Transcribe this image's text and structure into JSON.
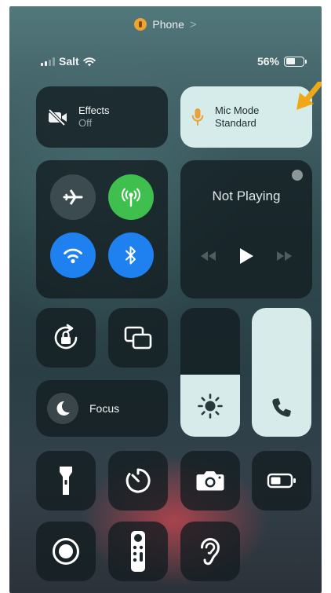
{
  "banner": {
    "app": "Phone",
    "chevron": ">"
  },
  "status": {
    "carrier": "Salt",
    "battery_percent": "56%",
    "battery_level": 0.56
  },
  "effects": {
    "title": "Effects",
    "value": "Off",
    "icon": "video-off-icon"
  },
  "mic_mode": {
    "title": "Mic Mode",
    "value": "Standard",
    "icon": "microphone-icon"
  },
  "connectivity": {
    "airplane_mode": false,
    "cellular": true,
    "wifi": true,
    "bluetooth": true
  },
  "now_playing": {
    "title": "Not Playing"
  },
  "sliders": {
    "brightness_level": 0.48,
    "volume_level": 1.0
  },
  "focus": {
    "label": "Focus"
  },
  "colors": {
    "accent_green": "#3fc04e",
    "accent_blue": "#1f80ef",
    "mic_orange": "#e8a23a",
    "annotation_arrow": "#f0a818",
    "active_tile": "#d5ecea"
  },
  "controls": [
    "screen-rotation-lock-icon",
    "screen-mirroring-icon",
    "flashlight-icon",
    "timer-icon",
    "camera-icon",
    "low-power-mode-icon",
    "screen-recording-icon",
    "apple-tv-remote-icon",
    "hearing-icon"
  ]
}
